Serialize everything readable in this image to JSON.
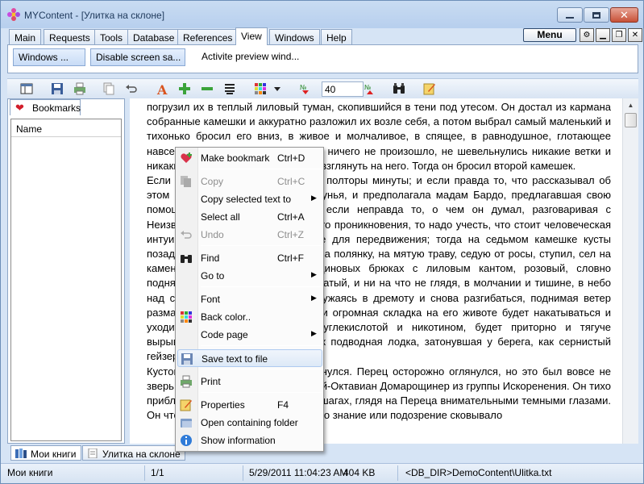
{
  "window": {
    "title": "MYContent - [Улитка на склоне]"
  },
  "menu_tabs": [
    "Main",
    "Requests",
    "Tools",
    "Database",
    "References",
    "View",
    "Windows",
    "Help"
  ],
  "menu_button": "Menu",
  "ribbon": {
    "buttons": [
      "Windows ...",
      "Disable screen sa..."
    ],
    "text": "Activite preview wind..."
  },
  "toolbar": {
    "zoom_value": "40"
  },
  "left_panel": {
    "tab": "Bookmarks",
    "column": "Name"
  },
  "content": {
    "paragraphs": [
      "погрузил их в теплый лиловый туман, скопившийся в тени под утесом. Он достал из кармана собранные камешки и аккуратно разложил их возле себя, а потом выбрал самый маленький и тихонько бросил его вниз, в живое и молчаливое, в спящее, в равнодушное, глотающее навсегда, и белая искра погасла, и ничего не произошло, не шевельнулись никакие ветки и никакие глаза не открылись, чтобы взглянуть на него. Тогда он бросил второй камешек.",
      "Если ориентироваться по звуку, то полторы минуты; и если правда то, что рассказывал об этом водитель по прозвищу Казалунья, и предполагала мадам Бардо, предлагавшая свою помощи местному населению; и если неправда то, о чем он думал, разговаривая с Неизвестным из группы инженерного проникновения, то надо учесть, что стоит человеческая интуиция; и если использовать ее для передвижения; тогда на седьмом камешке кусты позади зашумели, и кто-то вышел на полянку, на мятую траву, седую от росы, ступил, сел на камень в широких серых габардиновых брюках с лиловым кантом, розовый, словно поднявшийся, желто-розовый, мохнатый, и ни на что не глядя, в молчании и тишине, в небо над собой, пойдет сгибаться, погружаясь в дремоту и снова разгибаться, поднимая ветер размахами широких и мягких рук, и огромная складка на его животе будет накатываться и уходить, и запах, насыщенный углекислотой и никотином, будет приторно и тягуче вырываться из разинутого рта. Как подводная лодка, затонувшая у берега, как сернистый гейзер на Парамушире…",
      "Кустов перестало быть, и он обернулся. Перец осторожно оглянулся, но это был вовсе не зверь, а маленький человек Клавдий-Октавиан Домарощинер из группы Искоренения. Он тихо приблизился и остановился в двух шагах, глядя на Переца внимательными темными глазами. Он что-то знал или подозревал, и это знание или подозрение сковывало"
    ]
  },
  "context_menu": [
    {
      "label": "Make bookmark",
      "accel": "Ctrl+D",
      "icon": "heart-plus-icon"
    },
    {
      "sep": true
    },
    {
      "label": "Copy",
      "accel": "Ctrl+C",
      "disabled": true,
      "icon": "copy-icon"
    },
    {
      "label": "Copy selected text to",
      "submenu": true
    },
    {
      "label": "Select all",
      "accel": "Ctrl+A"
    },
    {
      "label": "Undo",
      "accel": "Ctrl+Z",
      "disabled": true,
      "icon": "undo-icon"
    },
    {
      "sep": true
    },
    {
      "label": "Find",
      "accel": "Ctrl+F",
      "icon": "binoculars-icon"
    },
    {
      "label": "Go to",
      "submenu": true
    },
    {
      "sep": true
    },
    {
      "label": "Font",
      "submenu": true
    },
    {
      "label": "Back color..",
      "icon": "palette-icon"
    },
    {
      "label": "Code page",
      "submenu": true
    },
    {
      "sep": true
    },
    {
      "label": "Save text to file",
      "icon": "save-icon",
      "highlighted": true
    },
    {
      "sep": true
    },
    {
      "label": "Print",
      "icon": "print-icon"
    },
    {
      "sep": true
    },
    {
      "label": "Properties",
      "accel": "F4",
      "icon": "properties-icon"
    },
    {
      "label": "Open containing folder",
      "icon": "folder-icon"
    },
    {
      "label": "Show information",
      "icon": "info-icon"
    }
  ],
  "bottom_tabs": [
    "Мои книги",
    "Улитка на склоне"
  ],
  "status": {
    "left": "Мои книги",
    "page": "1/1",
    "datetime": "5/29/2011 11:04:23 AM",
    "size": "404 KB",
    "path": "<DB_DIR>DemoContent\\Ulitka.txt"
  }
}
